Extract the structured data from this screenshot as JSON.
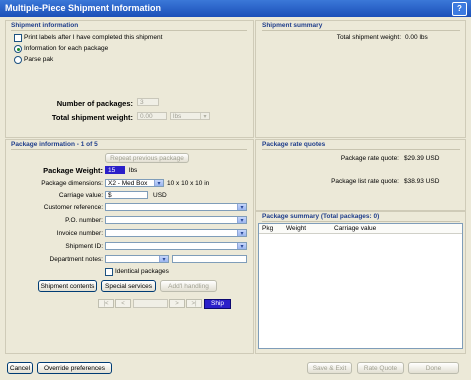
{
  "title": "Multiple-Piece Shipment Information",
  "help_glyph": "?",
  "shipment_info": {
    "heading": "Shipment information",
    "print_labels": "Print labels after I have completed this shipment",
    "info_each": "Information for each package",
    "parse_pak": "Parse pak",
    "num_packages_label": "Number of packages:",
    "num_packages_value": "3",
    "total_weight_label": "Total shipment weight:",
    "total_weight_value": "0.00",
    "total_weight_unit": "lbs"
  },
  "shipment_summary": {
    "heading": "Shipment summary",
    "total_label": "Total shipment weight:",
    "total_value": "0.00 lbs"
  },
  "package_info": {
    "heading": "Package information - 1 of 5",
    "repeat_btn": "Repeat previous package",
    "weight_label": "Package Weight:",
    "weight_value": "15",
    "weight_unit": "lbs",
    "dims_label": "Package dimensions:",
    "dims_value": "X2 - Med Box",
    "dims_text": "10 x 10 x 10 in",
    "carriage_label": "Carriage value:",
    "carriage_value": "$",
    "carriage_unit": "USD",
    "customer_ref": "Customer reference:",
    "po_number": "P.O. number:",
    "invoice_number": "Invoice number:",
    "shipment_id": "Shipment ID:",
    "dept_notes": "Department notes:",
    "identical": "Identical packages",
    "contents_btn": "Shipment contents",
    "services_btn": "Special services",
    "handling_btn": "Add'l handling",
    "nav_first": "|<",
    "nav_prev": "<",
    "nav_next": ">",
    "nav_last": ">|",
    "ship_btn": "Ship"
  },
  "rate_quotes": {
    "heading": "Package rate quotes",
    "rate_label": "Package rate quote:",
    "rate_value": "$29.39 USD",
    "list_label": "Package list rate quote:",
    "list_value": "$38.93 USD"
  },
  "pkg_summary": {
    "heading": "Package summary (Total packages: 0)",
    "columns": [
      "Pkg",
      "Weight",
      "Carriage value"
    ]
  },
  "footer": {
    "cancel": "Cancel",
    "override": "Override preferences",
    "save_exit": "Save & Exit",
    "rate_quote": "Rate Quote",
    "done": "Done"
  }
}
